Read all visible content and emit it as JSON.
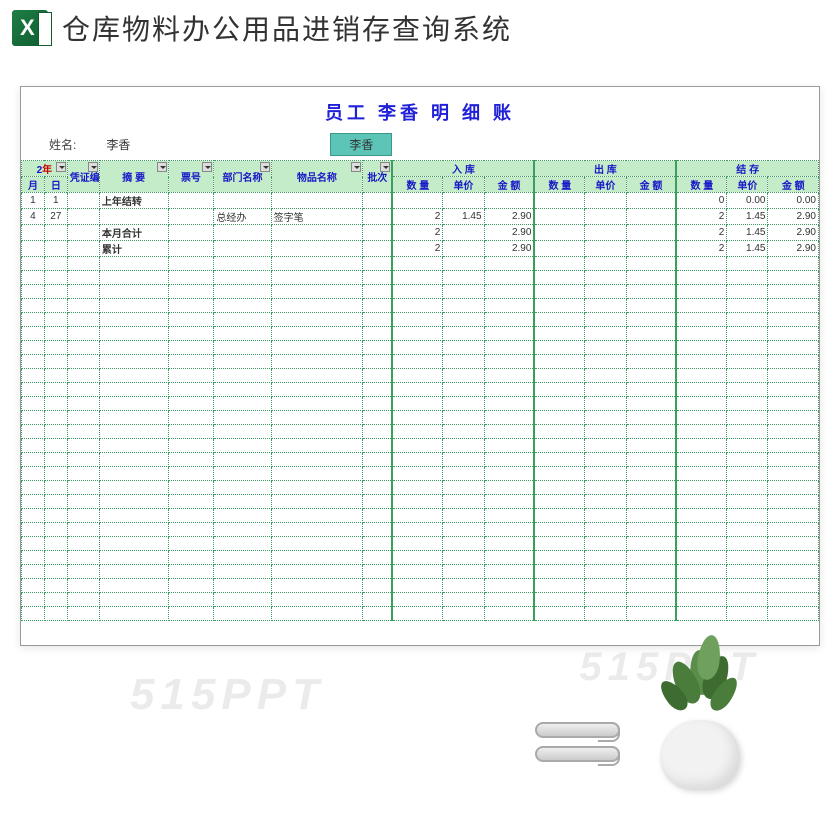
{
  "app": {
    "title": "仓库物料办公用品进销存查询系统"
  },
  "sheet": {
    "title": "员工 李香 明 细 账",
    "name_label": "姓名:",
    "name_value": "李香",
    "name_button": "李香"
  },
  "headers": {
    "year_prefix": "2",
    "year": "年",
    "month": "月",
    "day": "日",
    "code": "凭证编号",
    "summary": "摘   要",
    "ticket": "票号",
    "dept": "部门名称",
    "item": "物品名称",
    "batch": "批次",
    "in": "入     库",
    "out": "出     库",
    "balance": "结     存",
    "qty": "数 量",
    "price": "单价",
    "amount": "金 额"
  },
  "rows": [
    {
      "month": "1",
      "day": "1",
      "summary": "上年结转",
      "summary_red": true,
      "dept": "",
      "item": "",
      "in_qty": "",
      "in_price": "",
      "in_amt": "",
      "bal_qty": "0",
      "bal_price": "0.00",
      "bal_amt": "0.00"
    },
    {
      "month": "4",
      "day": "27",
      "summary": "",
      "dept": "总经办",
      "item": "签字笔",
      "in_qty": "2",
      "in_price": "1.45",
      "in_amt": "2.90",
      "bal_qty": "2",
      "bal_price": "1.45",
      "bal_amt": "2.90"
    },
    {
      "month": "",
      "day": "",
      "summary": "本月合计",
      "summary_red": true,
      "dept": "",
      "item": "",
      "in_qty": "2",
      "in_price": "",
      "in_amt": "2.90",
      "bal_qty": "2",
      "bal_price": "1.45",
      "bal_amt": "2.90"
    },
    {
      "month": "",
      "day": "",
      "summary": "累计",
      "summary_red": true,
      "dept": "",
      "item": "",
      "in_qty": "2",
      "in_price": "",
      "in_amt": "2.90",
      "bal_qty": "2",
      "bal_price": "1.45",
      "bal_amt": "2.90"
    }
  ],
  "watermark": "515PPT"
}
